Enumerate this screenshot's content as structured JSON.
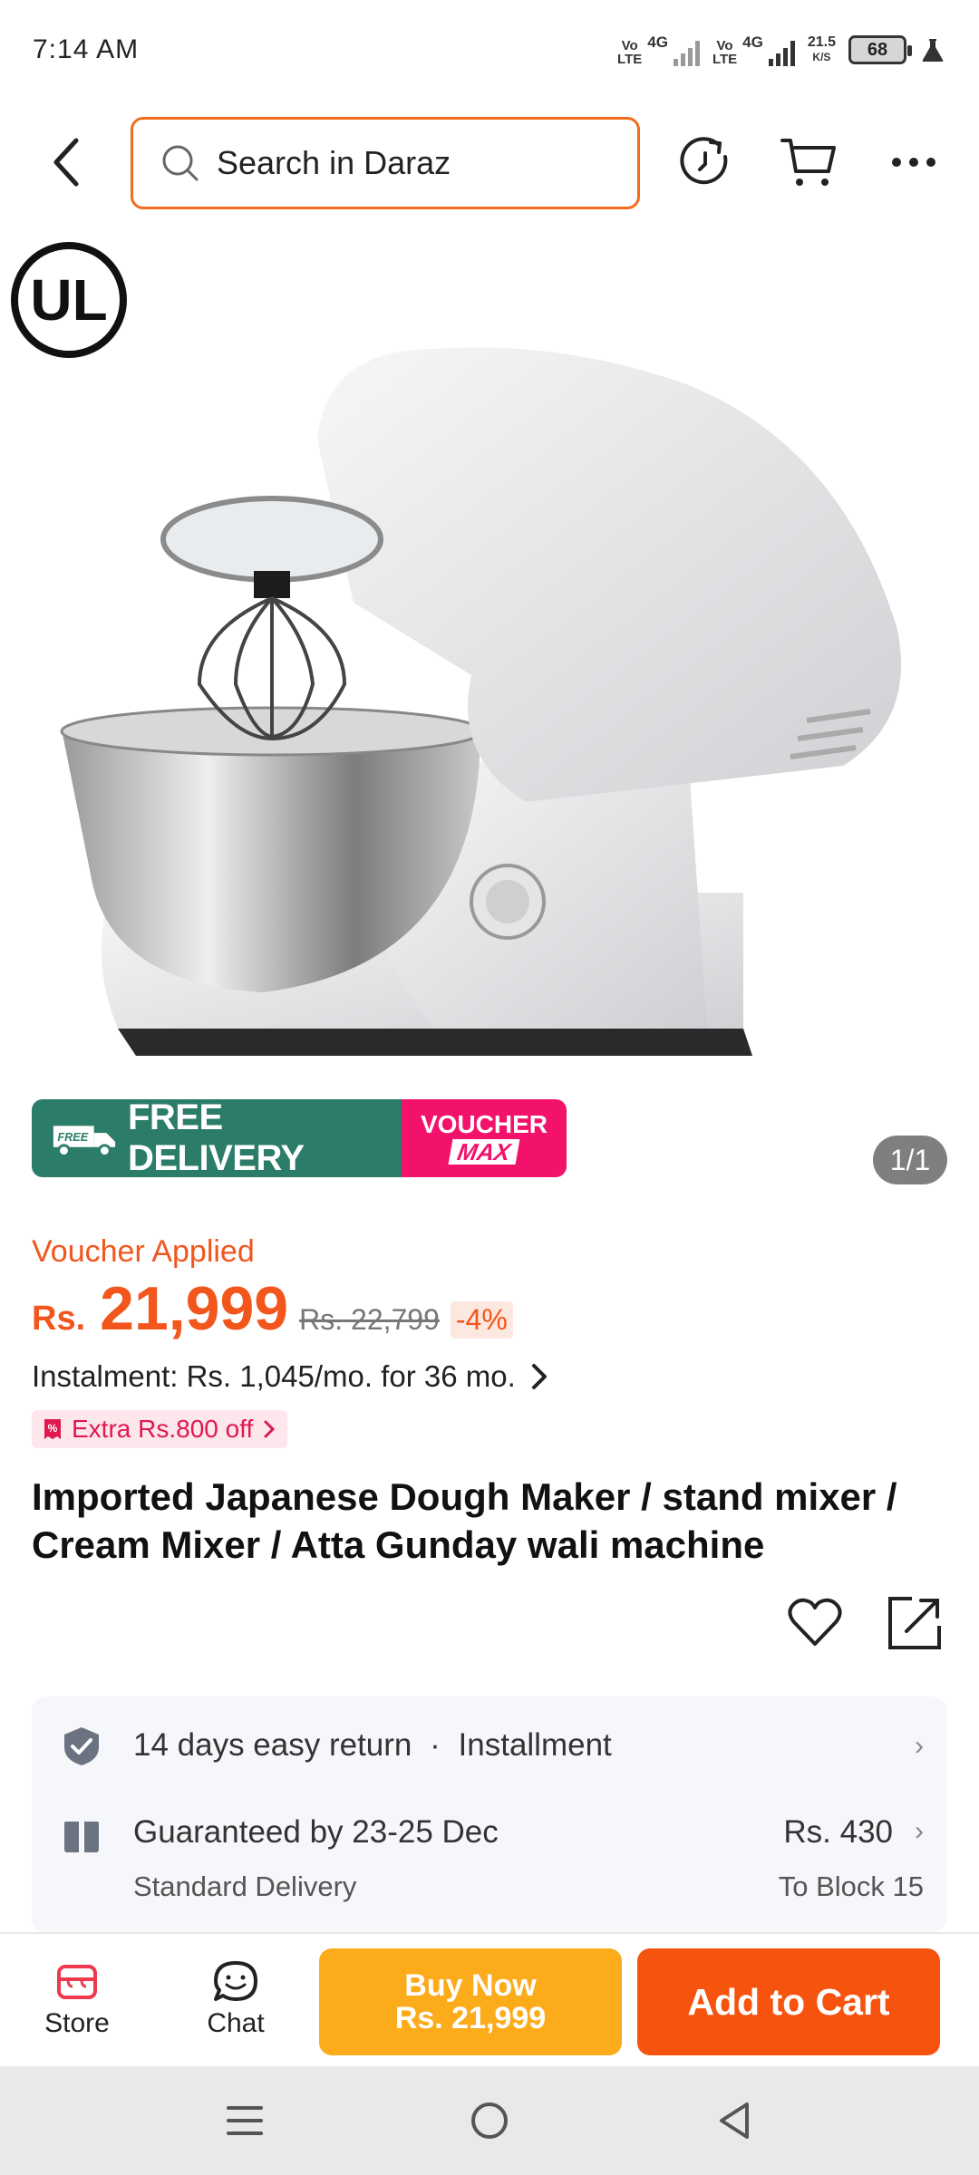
{
  "status_bar": {
    "time": "7:14 AM",
    "sim1_volte": "Vo\nLTE",
    "sim1_net": "4G",
    "sim2_volte": "Vo\nLTE",
    "sim2_net": "4G",
    "speed_value": "21.5",
    "speed_unit": "K/S",
    "battery": "68"
  },
  "header": {
    "search_placeholder": "Search in Daraz"
  },
  "hero": {
    "cert_logo": "UL",
    "promo_free_tag": "FREE",
    "promo_delivery": "FREE DELIVERY",
    "promo_voucher_top": "VOUCHER",
    "promo_voucher_bottom": "MAX",
    "page_indicator": "1/1"
  },
  "product": {
    "voucher_applied": "Voucher Applied",
    "currency": "Rs.",
    "price": "21,999",
    "original_price": "Rs. 22,799",
    "discount": "-4%",
    "instalment": "Instalment: Rs. 1,045/mo. for 36 mo.",
    "extra_off": "Extra Rs.800 off",
    "title": "Imported Japanese Dough Maker / stand mixer / Cream Mixer / Atta Gunday wali machine"
  },
  "services": {
    "return_text": "14 days easy return",
    "separator": "·",
    "installment_text": "Installment",
    "delivery_title": "Guaranteed by 23-25 Dec",
    "delivery_sub": "Standard Delivery",
    "delivery_fee": "Rs. 430",
    "delivery_dest": "To Block 15"
  },
  "action_bar": {
    "store_label": "Store",
    "chat_label": "Chat",
    "buy_now_label": "Buy Now",
    "buy_now_price": "Rs. 21,999",
    "add_to_cart_label": "Add to Cart"
  },
  "colors": {
    "brand_orange": "#f36c1c",
    "price_orange": "#f2561d",
    "buy_now": "#fcab1b",
    "add_to_cart": "#f6530e",
    "promo_green": "#2b7c69",
    "promo_pink": "#f2126b"
  }
}
